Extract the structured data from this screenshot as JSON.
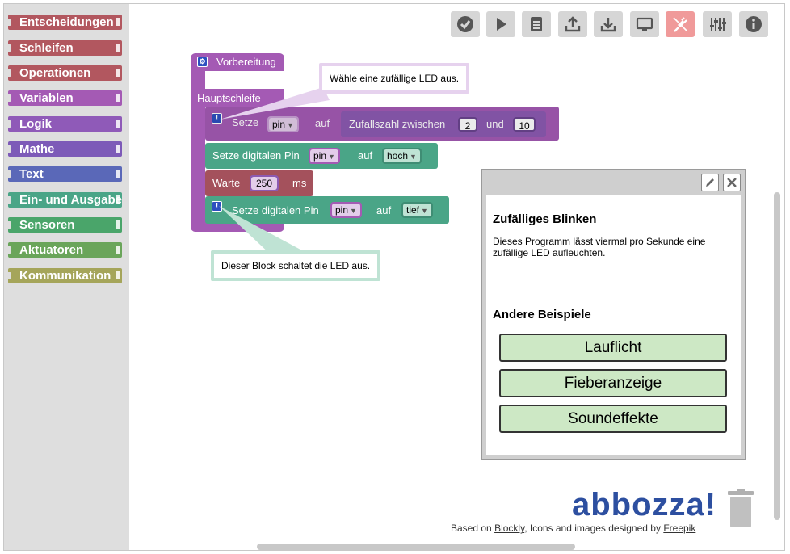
{
  "toolbox": {
    "categories": [
      {
        "label": "Entscheidungen",
        "color": "#b2575f"
      },
      {
        "label": "Schleifen",
        "color": "#b2575f"
      },
      {
        "label": "Operationen",
        "color": "#b2575f"
      },
      {
        "label": "Variablen",
        "color": "#a45ab4"
      },
      {
        "label": "Logik",
        "color": "#8f5ab8"
      },
      {
        "label": "Mathe",
        "color": "#7d5ab8"
      },
      {
        "label": "Text",
        "color": "#5a68b8"
      },
      {
        "label": "Ein- und Ausgabe",
        "color": "#4aa587"
      },
      {
        "label": "Sensoren",
        "color": "#4aa56a"
      },
      {
        "label": "Aktuatoren",
        "color": "#6aa55a"
      },
      {
        "label": "Kommunikation",
        "color": "#a5a55a"
      }
    ]
  },
  "toolbar": {
    "buttons": [
      {
        "name": "check-icon"
      },
      {
        "name": "play-icon"
      },
      {
        "name": "document-icon"
      },
      {
        "name": "upload-icon"
      },
      {
        "name": "download-icon"
      },
      {
        "name": "monitor-icon"
      },
      {
        "name": "plug-icon",
        "active": true
      },
      {
        "name": "sliders-icon"
      },
      {
        "name": "info-icon"
      }
    ],
    "active_color": "#f09a9a"
  },
  "workspace": {
    "setup_label": "Vorbereitung",
    "loop_label": "Hauptschleife",
    "set_label": "Setze",
    "set_var": "pin",
    "set_to": "auf",
    "random_label": "Zufallszahl zwischen",
    "random_min": "2",
    "random_and": "und",
    "random_max": "10",
    "digital_label": "Setze digitalen Pin",
    "digital_pin": "pin",
    "digital_to": "auf",
    "digital_high": "hoch",
    "wait_label": "Warte",
    "wait_value": "250",
    "wait_unit": "ms",
    "digital2_label": "Setze digitalen Pin",
    "digital2_pin": "pin",
    "digital2_to": "auf",
    "digital2_low": "tief",
    "comment1": "Wähle eine zufällige LED aus.",
    "comment2": "Dieser Block schaltet die LED aus."
  },
  "info_panel": {
    "title": "Zufälliges Blinken",
    "description": "Dieses Programm lässt viermal pro Sekunde eine zufällige LED aufleuchten.",
    "examples_heading": "Andere Beispiele",
    "examples": [
      "Lauflicht",
      "Fieberanzeige",
      "Soundeffekte"
    ]
  },
  "footer": {
    "logo": "abbozza!",
    "based_on": "Based on",
    "blockly": "Blockly",
    "middle": ", Icons and images designed by",
    "freepik": "Freepik"
  }
}
